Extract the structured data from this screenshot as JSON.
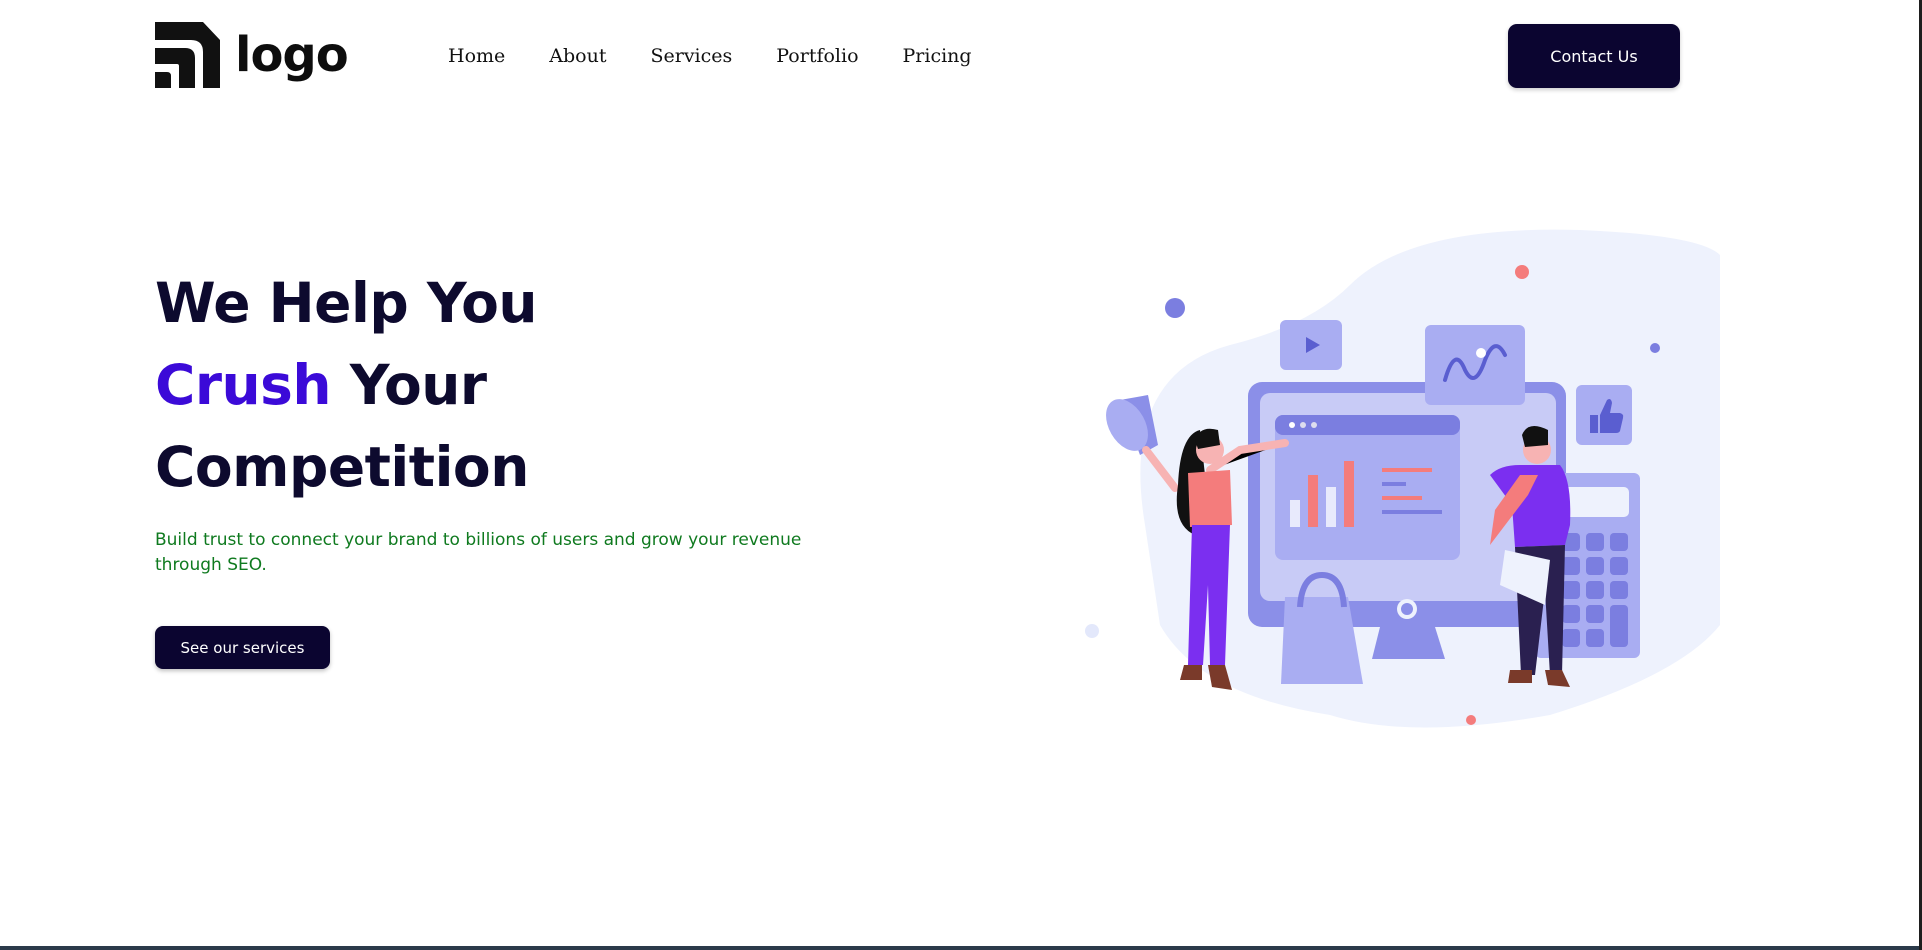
{
  "header": {
    "logo_text": "logo",
    "nav": [
      "Home",
      "About",
      "Services",
      "Portfolio",
      "Pricing"
    ],
    "contact_label": "Contact Us"
  },
  "hero": {
    "title_line1": "We Help You",
    "title_accent": "Crush",
    "title_line2_rest": " Your",
    "title_line3": "Competition",
    "subtitle": "Build trust to connect your brand to billions of users and grow your revenue through SEO.",
    "cta_label": "See our services"
  },
  "colors": {
    "navy": "#0b0530",
    "accent_purple": "#3b0ad8",
    "subtitle_green": "#0f7a1f",
    "illustration_periwinkle": "#8b8fe8",
    "illustration_coral": "#f47c7c"
  }
}
